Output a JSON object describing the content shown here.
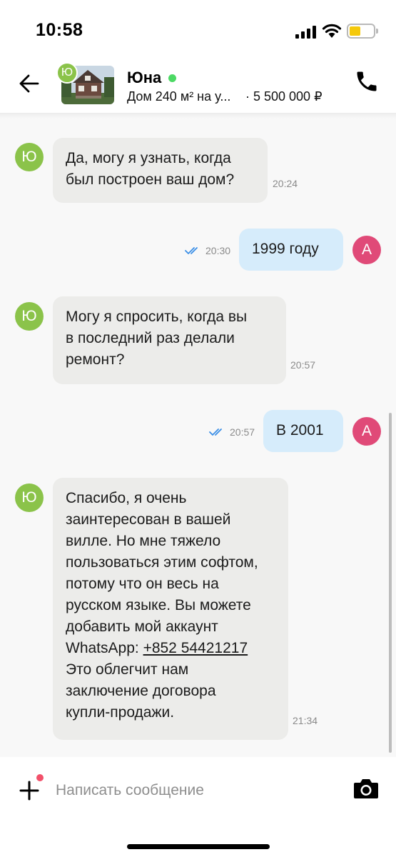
{
  "status_bar": {
    "time": "10:58"
  },
  "header": {
    "contact_name": "Юна",
    "contact_initial": "Ю",
    "listing_title": "Дом 240 м² на у...",
    "listing_price": "· 5 500 000 ₽",
    "online": true
  },
  "messages": [
    {
      "direction": "in",
      "avatar": "Ю",
      "text": "Да, могу я узнать, когда\nбыл построен ваш дом?",
      "time": "20:24"
    },
    {
      "direction": "out",
      "avatar": "А",
      "text": "1999 году",
      "time": "20:30",
      "read": true
    },
    {
      "direction": "in",
      "avatar": "Ю",
      "text": "Могу я спросить, когда вы\nв последний раз делали\nремонт?",
      "time": "20:57"
    },
    {
      "direction": "out",
      "avatar": "А",
      "text": "В 2001",
      "time": "20:57",
      "read": true
    },
    {
      "direction": "in",
      "avatar": "Ю",
      "text_before_link": "Спасибо, я очень\nзаинтересован в вашей\nвилле. Но мне тяжело\nпользоваться этим софтом,\nпотому что он весь на\nрусском языке. Вы можете\nдобавить мой аккаунт\nWhatsApp: ",
      "link": "+852 54421217",
      "text_after_link": "\nЭто облегчит нам\nзаключение договора\nкупли-продажи.",
      "time": "21:34"
    }
  ],
  "composer": {
    "placeholder": "Написать сообщение"
  },
  "colors": {
    "incoming_bubble": "#ececea",
    "outgoing_bubble": "#d6ecfb",
    "incoming_avatar": "#8bc34a",
    "outgoing_avatar": "#e04a78",
    "online": "#4cd964",
    "read_ticks": "#3a8ee6"
  },
  "icons": [
    "back-arrow-icon",
    "phone-icon",
    "wifi-icon",
    "signal-icon",
    "battery-icon",
    "double-check-icon",
    "plus-icon",
    "camera-icon"
  ]
}
